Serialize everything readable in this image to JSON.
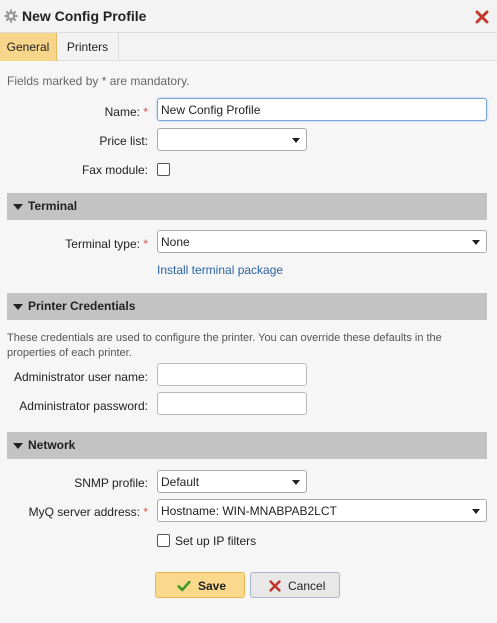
{
  "window": {
    "title": "New Config Profile",
    "title_icon": "gear-icon",
    "close_icon": "close-icon"
  },
  "tabs": [
    {
      "label": "General",
      "active": true
    },
    {
      "label": "Printers",
      "active": false
    }
  ],
  "mandatory_note": "Fields marked by * are mandatory.",
  "general": {
    "name_label": "Name:",
    "name_value": "New Config Profile",
    "price_list_label": "Price list:",
    "price_list_value": "",
    "fax_label": "Fax module:",
    "fax_checked": false
  },
  "terminal": {
    "section_title": "Terminal",
    "type_label": "Terminal type:",
    "type_value": "None",
    "install_link": "Install terminal package"
  },
  "credentials": {
    "section_title": "Printer Credentials",
    "description": "These credentials are used to configure the printer. You can override these defaults in the properties of each printer.",
    "admin_user_label": "Administrator user name:",
    "admin_user_value": "",
    "admin_pass_label": "Administrator password:",
    "admin_pass_value": ""
  },
  "network": {
    "section_title": "Network",
    "snmp_label": "SNMP profile:",
    "snmp_value": "Default",
    "server_label": "MyQ server address:",
    "server_value": "Hostname: WIN-MNABPAB2LCT",
    "ip_filters_label": "Set up IP filters",
    "ip_filters_checked": false
  },
  "buttons": {
    "save_label": "Save",
    "cancel_label": "Cancel"
  },
  "colors": {
    "active_tab": "#f7d58b",
    "section_header": "#c3c3c3",
    "required_star": "#d9534f",
    "link": "#2a64a6",
    "save_button": "#fbd98c"
  }
}
